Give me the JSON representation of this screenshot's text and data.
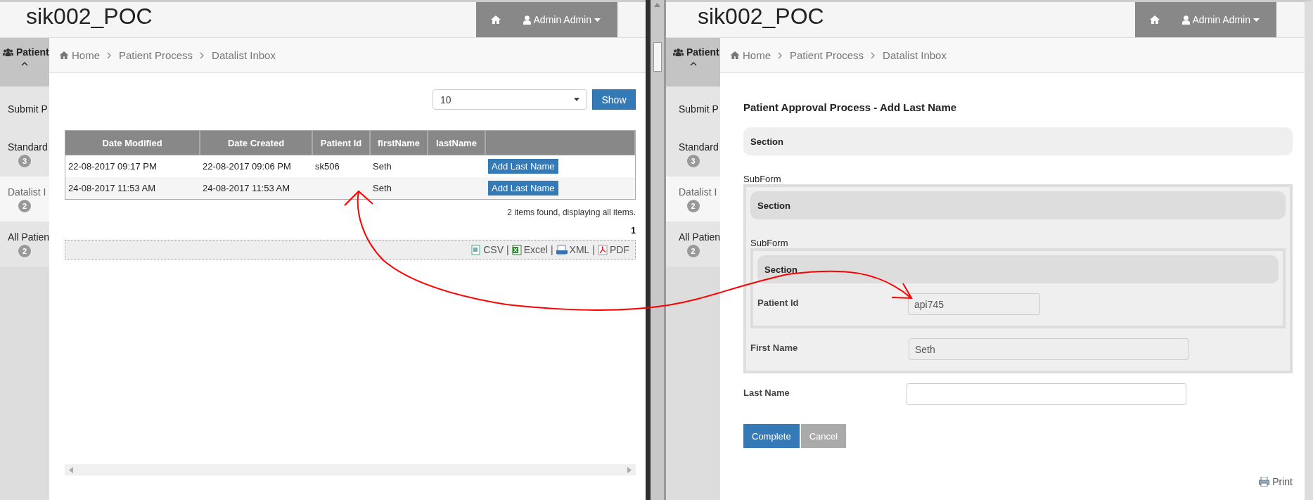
{
  "left_pane": {
    "header": {
      "title": "sik002_POC",
      "user": "Admin Admin"
    },
    "sidebar": {
      "group": {
        "label": "Patient",
        "expanded": true
      },
      "items": [
        {
          "label": "Submit P",
          "selected": false
        },
        {
          "label": "Standard",
          "badge": "3",
          "selected": false
        },
        {
          "label": "Datalist I",
          "badge": "2",
          "selected": true
        },
        {
          "label": "All Patien",
          "badge": "2",
          "selected": false
        }
      ]
    },
    "breadcrumb": [
      "Home",
      "Patient Process",
      "Datalist Inbox"
    ],
    "page_size": {
      "value": "10",
      "button": "Show"
    },
    "table": {
      "columns": [
        "Date Modified",
        "Date Created",
        "Patient Id",
        "firstName",
        "lastName",
        ""
      ],
      "rows": [
        {
          "cells": [
            "22-08-2017 09:17 PM",
            "22-08-2017 09:06 PM",
            "sk506",
            "Seth",
            ""
          ],
          "action": "Add Last Name"
        },
        {
          "cells": [
            "24-08-2017 11:53 AM",
            "24-08-2017 11:53 AM",
            "",
            "Seth",
            ""
          ],
          "action": "Add Last Name"
        }
      ]
    },
    "summary": "2 items found, displaying all items.",
    "page": "1",
    "exports": [
      {
        "label": "CSV",
        "kind": "csv"
      },
      {
        "label": "Excel",
        "kind": "excel"
      },
      {
        "label": "XML",
        "kind": "xml"
      },
      {
        "label": "PDF",
        "kind": "pdf"
      }
    ],
    "export_separator": "|"
  },
  "right_pane": {
    "header": {
      "title": "sik002_POC",
      "user": "Admin Admin"
    },
    "sidebar": {
      "group": {
        "label": "Patient",
        "expanded": true
      },
      "items": [
        {
          "label": "Submit P",
          "selected": false
        },
        {
          "label": "Standard",
          "badge": "3",
          "selected": false
        },
        {
          "label": "Datalist I",
          "badge": "2",
          "selected": true
        },
        {
          "label": "All Patien",
          "badge": "2",
          "selected": false
        }
      ]
    },
    "breadcrumb": [
      "Home",
      "Patient Process",
      "Datalist Inbox"
    ],
    "form": {
      "title": "Patient Approval Process - Add Last Name",
      "section": "Section",
      "subform": {
        "legend": "SubForm",
        "section": "Section",
        "subform": {
          "legend": "SubForm",
          "section": "Section",
          "fields": [
            {
              "label": "Patient Id",
              "value": "api745",
              "readonly": true
            }
          ]
        },
        "fields": [
          {
            "label": "First Name",
            "value": "Seth",
            "readonly": true
          }
        ]
      },
      "fields": [
        {
          "label": "Last Name",
          "readonly": false
        }
      ],
      "buttons": [
        {
          "label": "Complete",
          "kind": "primary"
        },
        {
          "label": "Cancel",
          "kind": "secondary"
        }
      ],
      "print": "Print"
    }
  }
}
